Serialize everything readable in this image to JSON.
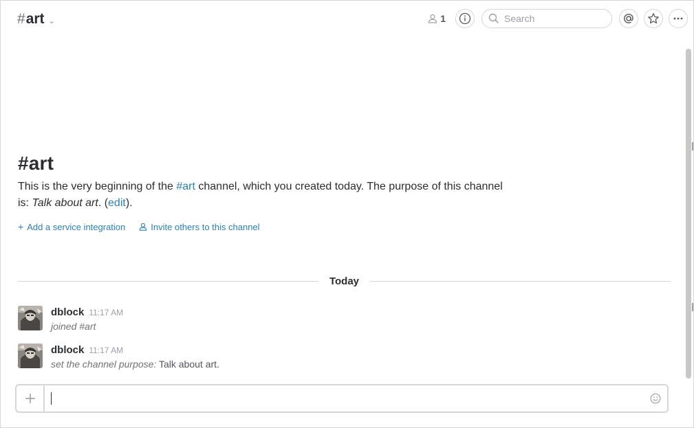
{
  "header": {
    "hash": "#",
    "channel": "art",
    "member_count": "1",
    "search_placeholder": "Search"
  },
  "intro": {
    "title": "#art",
    "text_before": "This is the very beginning of the ",
    "channel_link": "#art",
    "text_after": " channel, which you created today. The purpose of this channel is: ",
    "purpose": "Talk about art",
    "text_end": ". (",
    "edit_link": "edit",
    "text_close": ").",
    "actions": {
      "add_integration": "Add a service integration",
      "invite": "Invite others to this channel"
    }
  },
  "divider": {
    "label": "Today"
  },
  "messages": [
    {
      "sender": "dblock",
      "time": "11:17 AM",
      "text_em": "joined #art",
      "text_plain": ""
    },
    {
      "sender": "dblock",
      "time": "11:17 AM",
      "text_em": "set the channel purpose:",
      "text_plain": " Talk about art."
    }
  ],
  "colors": {
    "link": "#2a80b9",
    "border": "#d6d6d6",
    "muted": "#9e9ea6"
  },
  "icons": {
    "member": "person-icon",
    "info": "info-icon",
    "search": "search-icon",
    "mention": "at-icon",
    "star": "star-icon",
    "more": "more-icon",
    "plus": "plus-icon",
    "emoji": "smiley-icon"
  }
}
